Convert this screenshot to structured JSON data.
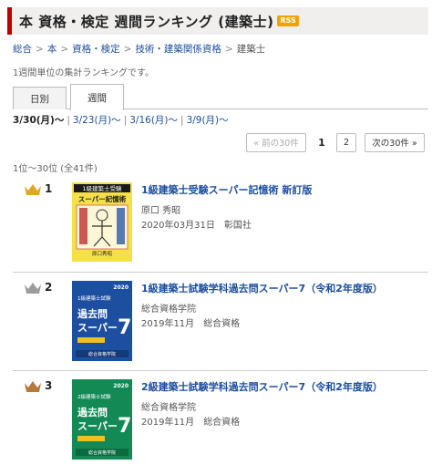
{
  "header": {
    "title": "本 資格・検定 週間ランキング (建築士)",
    "rss": "RSS",
    "accent": "#bf0000"
  },
  "breadcrumb": [
    "総合",
    "本",
    "資格・検定",
    "技術・建築関係資格",
    "建築士"
  ],
  "description": "1週間単位の集計ランキングです。",
  "tabs": [
    "日別",
    "週間"
  ],
  "weeks": {
    "current": "3/30(月)〜",
    "others": [
      "3/23(月)〜",
      "3/16(月)〜",
      "3/9(月)〜"
    ]
  },
  "pager": {
    "prev": "« 前の30件",
    "current": "1",
    "page2": "2",
    "next": "次の30件 »"
  },
  "range": "1位〜30位 (全41件)",
  "items": [
    {
      "rank": "1",
      "crown": "gold-crown-icon",
      "title": "1級建築士受験スーパー記憶術 新訂版",
      "author": "原口 秀昭",
      "date": "2020年03月31日",
      "publisher": "彰国社",
      "cover": {
        "top_band": "1級建築士受験",
        "main": "スーパー記憶術",
        "sub": "新訂版",
        "bottom": "原口秀昭"
      }
    },
    {
      "rank": "2",
      "crown": "silver-crown-icon",
      "title": "1級建築士試験学科過去問スーパー7（令和2年度版）",
      "author": "総合資格学院",
      "date": "2019年11月",
      "publisher": "総合資格",
      "cover": {
        "year": "2020",
        "top": "1級建築士試験",
        "main1": "過去問",
        "main2": "スーパー",
        "num": "7",
        "badge": "総合資格学院"
      }
    },
    {
      "rank": "3",
      "crown": "bronze-crown-icon",
      "title": "2級建築士試験学科過去問スーパー7（令和2年度版）",
      "author": "総合資格学院",
      "date": "2019年11月",
      "publisher": "総合資格",
      "cover": {
        "year": "2020",
        "top": "2級建築士試験",
        "main1": "過去問",
        "main2": "スーパー",
        "num": "7",
        "badge": "総合資格学院"
      }
    }
  ]
}
